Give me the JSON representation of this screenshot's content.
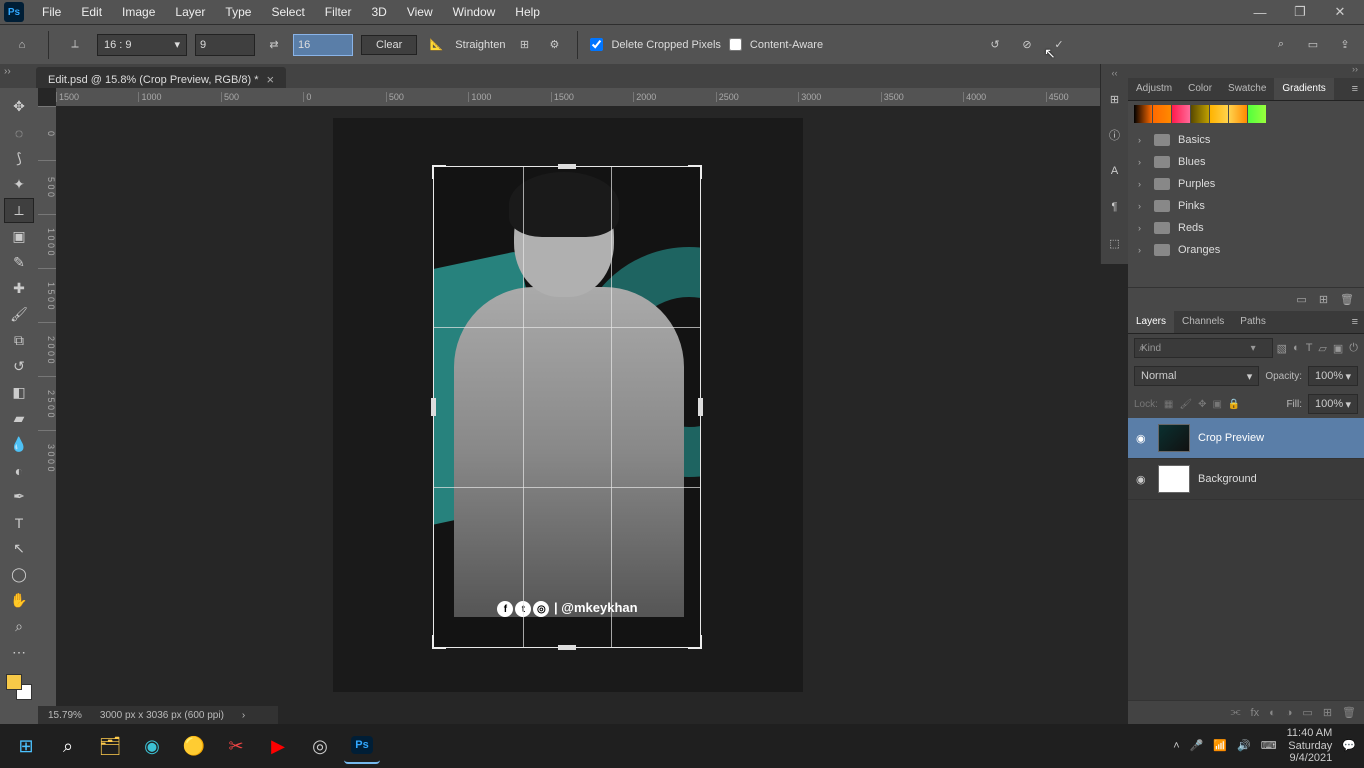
{
  "menubar": [
    "File",
    "Edit",
    "Image",
    "Layer",
    "Type",
    "Select",
    "Filter",
    "3D",
    "View",
    "Window",
    "Help"
  ],
  "options": {
    "ratio_preset": "16 : 9",
    "ratio_w": "9",
    "ratio_h": "16",
    "clear": "Clear",
    "straighten": "Straighten",
    "delete_cropped": "Delete Cropped Pixels",
    "content_aware": "Content-Aware"
  },
  "tab": {
    "title": "Edit.psd @ 15.8% (Crop Preview, RGB/8) *"
  },
  "ruler_top": [
    "1500",
    "1000",
    "500",
    "0",
    "500",
    "1000",
    "1500",
    "2000",
    "2500",
    "3000",
    "3500",
    "4000",
    "4500"
  ],
  "ruler_left": [
    "0",
    "5\n0\n0",
    "1\n0\n0\n0",
    "1\n5\n0\n0",
    "2\n0\n0\n0",
    "2\n5\n0\n0",
    "3\n0\n0\n0"
  ],
  "crop_text": "| @mkeykhan",
  "status": {
    "zoom": "15.79%",
    "docinfo": "3000 px x 3036 px (600 ppi)"
  },
  "panel_tabs_top": [
    "Adjustm",
    "Color",
    "Swatche",
    "Gradients"
  ],
  "gradients_swatches": [
    "#000000",
    "#ff6a00",
    "#ff1a4d",
    "#8e7a00",
    "#ffb300",
    "#ffd24d",
    "#52ff3d"
  ],
  "gradient_folders": [
    "Basics",
    "Blues",
    "Purples",
    "Pinks",
    "Reds",
    "Oranges"
  ],
  "panel_tabs_bottom": [
    "Layers",
    "Channels",
    "Paths"
  ],
  "layers": {
    "filter_placeholder": "Kind",
    "blend_mode": "Normal",
    "opacity_label": "Opacity:",
    "opacity_value": "100%",
    "fill_label": "Fill:",
    "fill_value": "100%",
    "lock_label": "Lock:",
    "items": [
      {
        "name": "Crop Preview"
      },
      {
        "name": "Background"
      }
    ]
  },
  "taskbar": {
    "time": "11:40 AM",
    "day": "Saturday",
    "date": "9/4/2021"
  }
}
